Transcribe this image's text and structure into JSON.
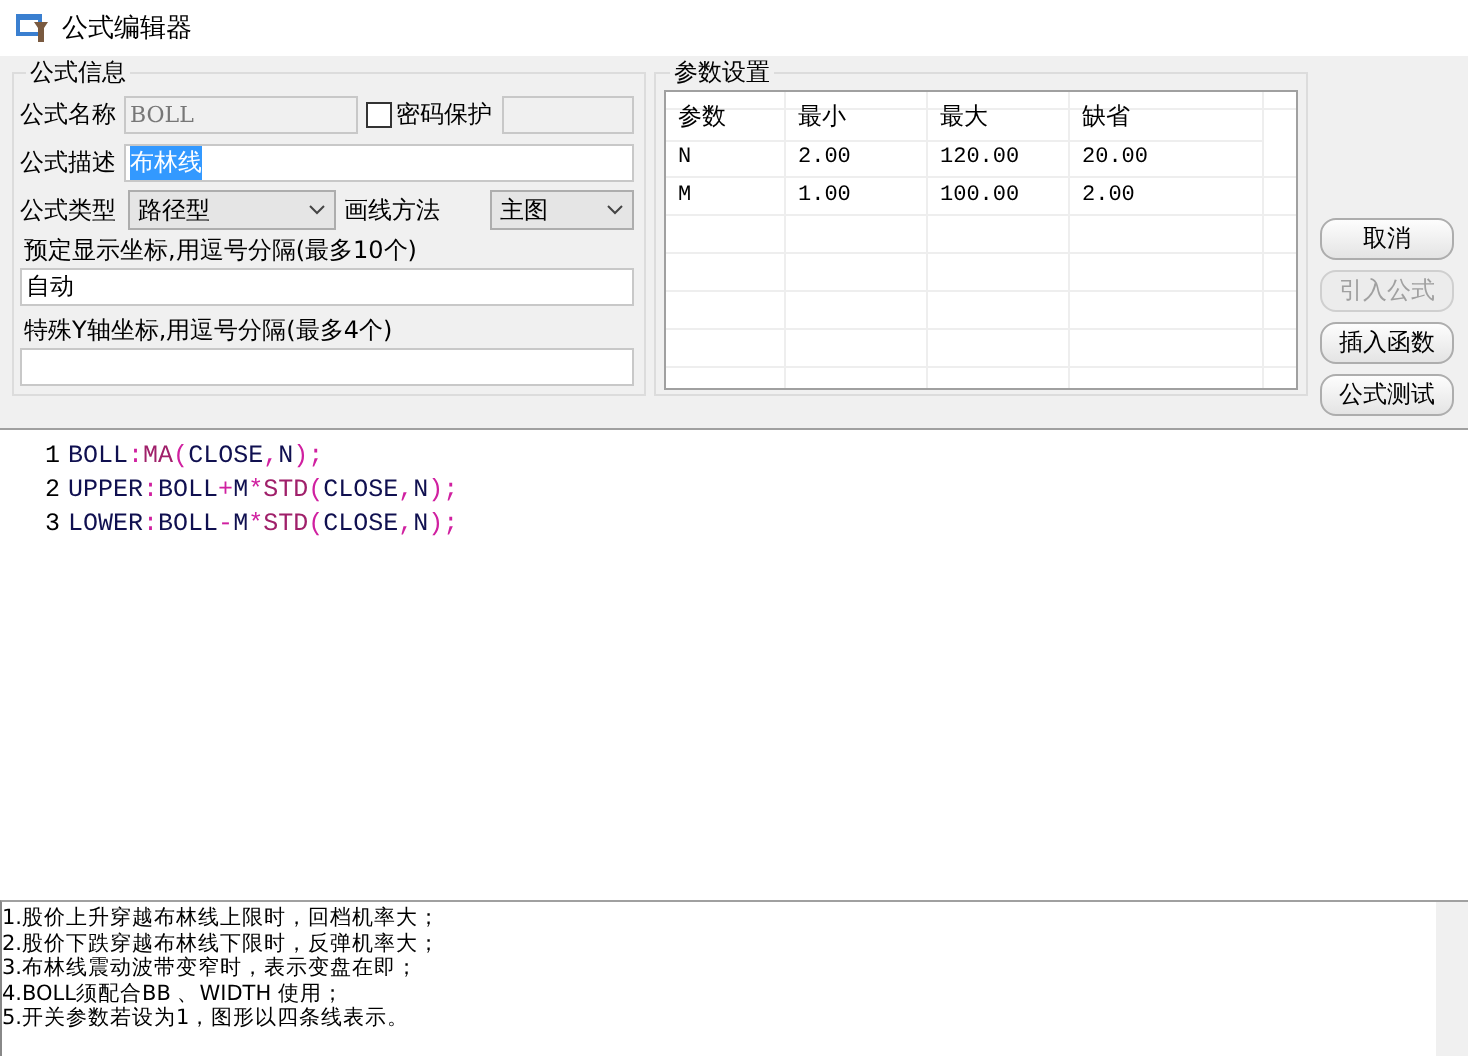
{
  "window": {
    "title": "公式编辑器"
  },
  "formula_info": {
    "title": "公式信息",
    "name_label": "公式名称",
    "name_value": "BOLL",
    "password": {
      "label": "密码保护",
      "checked": false
    },
    "desc_label": "公式描述",
    "desc_value": "布林线",
    "desc_highlighted": true,
    "type_label": "公式类型",
    "type_value": "路径型",
    "draw_label": "画线方法",
    "draw_value": "主图",
    "coords_label": "预定显示坐标,用逗号分隔(最多10个)",
    "coords_value": "自动",
    "yaxis_label": "特殊Y轴坐标,用逗号分隔(最多4个)"
  },
  "params": {
    "title": "参数设置",
    "columns": [
      "参数",
      "最小",
      "最大",
      "缺省"
    ],
    "rows": [
      [
        "N",
        "2.00",
        "120.00",
        "20.00"
      ],
      [
        "M",
        "1.00",
        "100.00",
        "2.00"
      ]
    ]
  },
  "buttons": [
    {
      "label": "取消",
      "disabled": false
    },
    {
      "label": "引入公式",
      "disabled": true
    },
    {
      "label": "插入函数",
      "disabled": false
    },
    {
      "label": "公式测试",
      "disabled": false
    }
  ],
  "editor": {
    "lines": [
      {
        "number": "1",
        "tokens": [
          {
            "text": "BOLL",
            "kind": "name"
          },
          {
            "text": ":",
            "kind": "op"
          },
          {
            "text": "MA",
            "kind": "func"
          },
          {
            "text": "(",
            "kind": "op"
          },
          {
            "text": "CLOSE",
            "kind": "name"
          },
          {
            "text": ",",
            "kind": "op"
          },
          {
            "text": "N",
            "kind": "name"
          },
          {
            "text": ");",
            "kind": "op"
          }
        ]
      },
      {
        "number": "2",
        "tokens": [
          {
            "text": "UPPER",
            "kind": "name"
          },
          {
            "text": ":",
            "kind": "op"
          },
          {
            "text": "BOLL",
            "kind": "name"
          },
          {
            "text": "+",
            "kind": "op"
          },
          {
            "text": "M",
            "kind": "name"
          },
          {
            "text": "*",
            "kind": "op"
          },
          {
            "text": "STD",
            "kind": "func"
          },
          {
            "text": "(",
            "kind": "op"
          },
          {
            "text": "CLOSE",
            "kind": "name"
          },
          {
            "text": ",",
            "kind": "op"
          },
          {
            "text": "N",
            "kind": "name"
          },
          {
            "text": ");",
            "kind": "op"
          }
        ]
      },
      {
        "number": "3",
        "tokens": [
          {
            "text": "LOWER",
            "kind": "name"
          },
          {
            "text": ":",
            "kind": "op"
          },
          {
            "text": "BOLL",
            "kind": "name"
          },
          {
            "text": "-",
            "kind": "op"
          },
          {
            "text": "M",
            "kind": "name"
          },
          {
            "text": "*",
            "kind": "op"
          },
          {
            "text": "STD",
            "kind": "func"
          },
          {
            "text": "(",
            "kind": "op"
          },
          {
            "text": "CLOSE",
            "kind": "name"
          },
          {
            "text": ",",
            "kind": "op"
          },
          {
            "text": "N",
            "kind": "name"
          },
          {
            "text": ");",
            "kind": "op"
          }
        ]
      }
    ]
  },
  "notes": [
    "1.股价上升穿越布林线上限时，回档机率大；",
    "2.股价下跌穿越布林线下限时，反弹机率大；",
    "3.布林线震动波带变窄时，表示变盘在即；",
    "4.BOLL须配合BB 、WIDTH 使用；",
    "5.开关参数若设为1，图形以四条线表示。"
  ]
}
